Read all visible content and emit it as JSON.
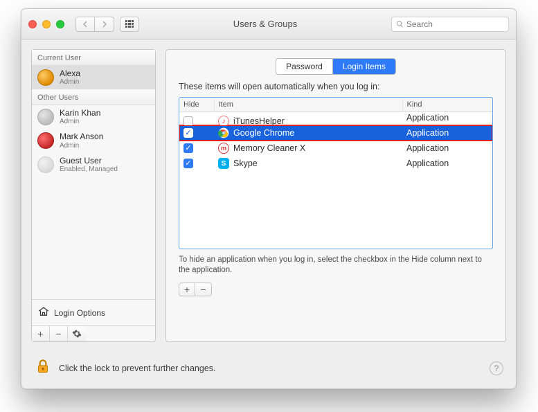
{
  "window": {
    "title": "Users & Groups"
  },
  "toolbar": {
    "search_placeholder": "Search"
  },
  "sidebar": {
    "current_label": "Current User",
    "other_label": "Other Users",
    "current": {
      "name": "Alexa",
      "role": "Admin"
    },
    "others": [
      {
        "name": "Karin Khan",
        "role": "Admin"
      },
      {
        "name": "Mark Anson",
        "role": "Admin"
      },
      {
        "name": "Guest User",
        "role": "Enabled, Managed"
      }
    ],
    "login_options": "Login Options"
  },
  "main": {
    "tabs": {
      "password": "Password",
      "login_items": "Login Items"
    },
    "instruction": "These items will open automatically when you log in:",
    "headers": {
      "hide": "Hide",
      "item": "Item",
      "kind": "Kind"
    },
    "rows": [
      {
        "hide": false,
        "name": "iTunesHelper",
        "kind": "Application"
      },
      {
        "hide": true,
        "name": "Google Chrome",
        "kind": "Application"
      },
      {
        "hide": true,
        "name": "Memory Cleaner X",
        "kind": "Application"
      },
      {
        "hide": true,
        "name": "Skype",
        "kind": "Application"
      }
    ],
    "hint": "To hide an application when you log in, select the checkbox in the Hide column next to the application."
  },
  "footer": {
    "lock_text": "Click the lock to prevent further changes."
  }
}
